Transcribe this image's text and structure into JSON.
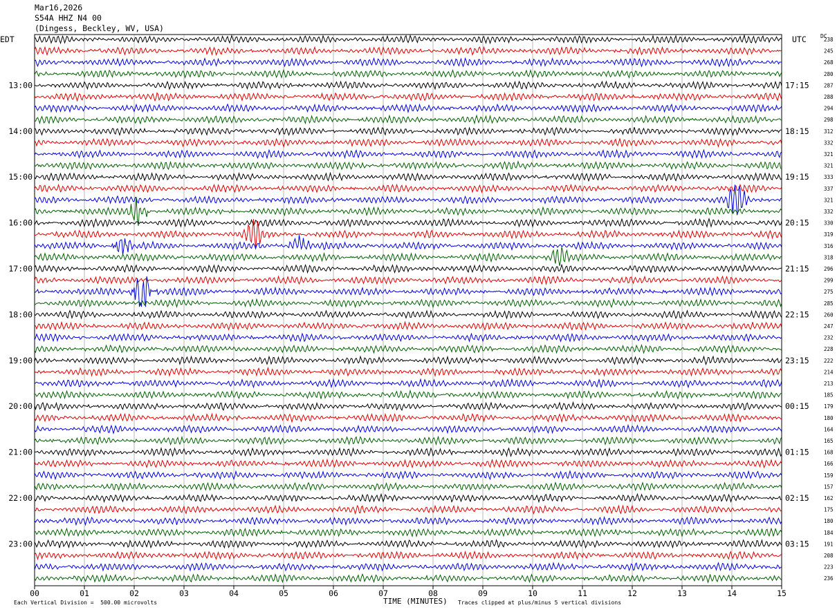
{
  "header": {
    "date": "Mar16,2026",
    "station": "S54A HHZ N4 00",
    "location": "(Dingess, Beckley, WV, USA)"
  },
  "left_zone_label": "EDT",
  "right_zone_label": "UTC",
  "dc_label": "DC",
  "footer": {
    "xlabel": "TIME (MINUTES)",
    "scale_note": "Each Vertical Division =  500.00 microvolts",
    "clip_note": "Traces clipped at plus/minus 5 vertical divisions"
  },
  "colors": {
    "trace_cycle": [
      "#000000",
      "#e00000",
      "#0000e0",
      "#006000"
    ],
    "grid": "#888888"
  },
  "chart_data": {
    "type": "line",
    "description": "24-hour helicorder, 15 minutes per trace line",
    "xlim": [
      0,
      15
    ],
    "x_ticks": [
      "00",
      "01",
      "02",
      "03",
      "04",
      "05",
      "06",
      "07",
      "08",
      "09",
      "10",
      "11",
      "12",
      "13",
      "14",
      "15"
    ],
    "y_ticks_left": [
      {
        "row": 4,
        "label": "13:00"
      },
      {
        "row": 8,
        "label": "14:00"
      },
      {
        "row": 12,
        "label": "15:00"
      },
      {
        "row": 16,
        "label": "16:00"
      },
      {
        "row": 20,
        "label": "17:00"
      },
      {
        "row": 24,
        "label": "18:00"
      },
      {
        "row": 28,
        "label": "19:00"
      },
      {
        "row": 32,
        "label": "20:00"
      },
      {
        "row": 36,
        "label": "21:00"
      },
      {
        "row": 40,
        "label": "22:00"
      },
      {
        "row": 44,
        "label": "23:00"
      }
    ],
    "y_ticks_right": [
      {
        "row": 4,
        "label": "17:15"
      },
      {
        "row": 8,
        "label": "18:15"
      },
      {
        "row": 12,
        "label": "19:15"
      },
      {
        "row": 16,
        "label": "20:15"
      },
      {
        "row": 20,
        "label": "21:15"
      },
      {
        "row": 24,
        "label": "22:15"
      },
      {
        "row": 28,
        "label": "23:15"
      },
      {
        "row": 32,
        "label": "00:15"
      },
      {
        "row": 36,
        "label": "01:15"
      },
      {
        "row": 40,
        "label": "02:15"
      },
      {
        "row": 44,
        "label": "03:15"
      }
    ],
    "dc_offsets": [
      238,
      245,
      268,
      280,
      287,
      288,
      294,
      298,
      312,
      332,
      321,
      321,
      333,
      337,
      321,
      332,
      330,
      319,
      316,
      318,
      296,
      299,
      275,
      285,
      260,
      247,
      232,
      228,
      222,
      214,
      213,
      185,
      179,
      180,
      164,
      165,
      168,
      166,
      159,
      157,
      162,
      175,
      180,
      184,
      191,
      208,
      223,
      236
    ],
    "events": [
      {
        "row": 15,
        "minute": 2.1,
        "amplitude": 2.5
      },
      {
        "row": 14,
        "minute": 14.1,
        "amplitude": 1.5
      },
      {
        "row": 17,
        "minute": 4.4,
        "amplitude": 1.2
      },
      {
        "row": 18,
        "minute": 1.75,
        "amplitude": 1.4
      },
      {
        "row": 18,
        "minute": 5.3,
        "amplitude": 1.5
      },
      {
        "row": 19,
        "minute": 10.5,
        "amplitude": 1.2
      },
      {
        "row": 22,
        "minute": 2.25,
        "amplitude": 1.6
      },
      {
        "row": 22,
        "minute": 2.1,
        "amplitude": 1.3
      }
    ]
  }
}
